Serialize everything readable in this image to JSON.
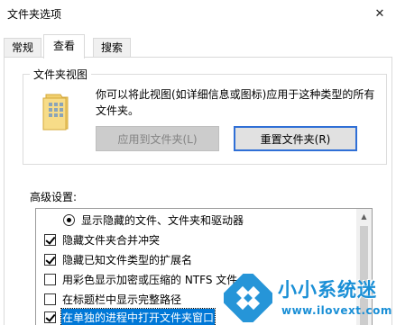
{
  "window": {
    "title": "文件夹选项",
    "close_glyph": "✕"
  },
  "tabs": [
    {
      "label": "常规",
      "active": false
    },
    {
      "label": "查看",
      "active": true
    },
    {
      "label": "搜索",
      "active": false
    }
  ],
  "folder_views": {
    "legend": "文件夹视图",
    "description": "你可以将此视图(如详细信息或图标)应用于这种类型的所有文件夹。",
    "apply_button": "应用到文件夹(L)",
    "reset_button": "重置文件夹(R)"
  },
  "advanced": {
    "label": "高级设置:",
    "items": [
      {
        "type": "radio",
        "selected": true,
        "indent": true,
        "label": "显示隐藏的文件、文件夹和驱动器"
      },
      {
        "type": "checkbox",
        "checked": true,
        "indent": false,
        "label": "隐藏文件夹合并冲突"
      },
      {
        "type": "checkbox",
        "checked": true,
        "indent": false,
        "label": "隐藏已知文件类型的扩展名"
      },
      {
        "type": "checkbox",
        "checked": false,
        "indent": false,
        "label": "用彩色显示加密或压缩的 NTFS 文件"
      },
      {
        "type": "checkbox",
        "checked": false,
        "indent": false,
        "label": "在标题栏中显示完整路径"
      },
      {
        "type": "checkbox",
        "checked": true,
        "indent": false,
        "label": "在单独的进程中打开文件夹窗口",
        "focused": true
      }
    ]
  },
  "watermark": {
    "title": "小小系统迷",
    "url": "www.ilovext.com",
    "brand_color": "#1a8fd6"
  }
}
